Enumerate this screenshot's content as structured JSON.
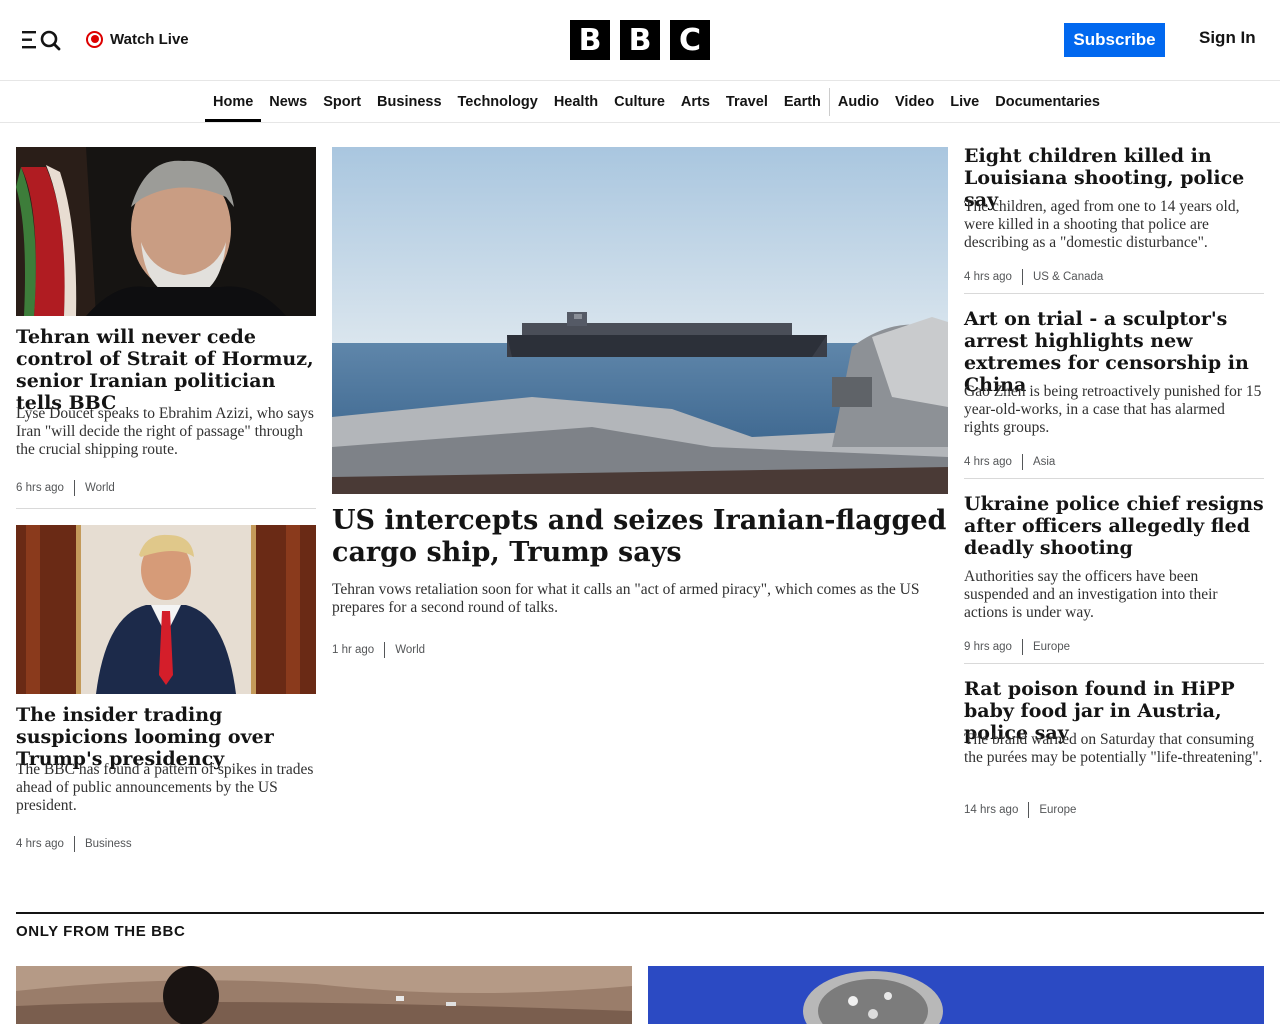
{
  "header": {
    "watch_live": "Watch Live",
    "logo_letters": [
      "B",
      "B",
      "C"
    ],
    "subscribe": "Subscribe",
    "sign_in": "Sign In"
  },
  "nav": [
    "Home",
    "News",
    "Sport",
    "Business",
    "Technology",
    "Health",
    "Culture",
    "Arts",
    "Travel",
    "Earth",
    "Audio",
    "Video",
    "Live",
    "Documentaries"
  ],
  "left_stories": [
    {
      "title": "Tehran will never cede control of Strait of Hormuz, senior Iranian politician tells BBC",
      "summary": "Lyse Doucet speaks to Ebrahim Azizi, who says Iran \"will decide the right of passage\" through the crucial shipping route.",
      "time": "6 hrs ago",
      "category": "World"
    },
    {
      "title": "The insider trading suspicions looming over Trump's presidency",
      "summary": "The BBC has found a pattern of spikes in trades ahead of public announcements by the US president.",
      "time": "4 hrs ago",
      "category": "Business"
    }
  ],
  "lead_story": {
    "title": "US intercepts and seizes Iranian-flagged cargo ship, Trump says",
    "summary": "Tehran vows retaliation soon for what it calls an \"act of armed piracy\", which comes as the US prepares for a second round of talks.",
    "time": "1 hr ago",
    "category": "World"
  },
  "right_stories": [
    {
      "title": "Eight children killed in Louisiana shooting, police say",
      "summary": "The children, aged from one to 14 years old, were killed in a shooting that police are describing as a \"domestic disturbance\".",
      "time": "4 hrs ago",
      "category": "US & Canada"
    },
    {
      "title": "Art on trial - a sculptor's arrest highlights new extremes for censorship in China",
      "summary": "Gao Zhen is being retroactively punished for 15 year-old-works, in a case that has alarmed rights groups.",
      "time": "4 hrs ago",
      "category": "Asia"
    },
    {
      "title": "Ukraine police chief resigns after officers allegedly fled deadly shooting",
      "summary": "Authorities say the officers have been suspended and an investigation into their actions is under way.",
      "time": "9 hrs ago",
      "category": "Europe"
    },
    {
      "title": "Rat poison found in HiPP baby food jar in Austria, police say",
      "summary": "The brand warned on Saturday that consuming the purées may be potentially \"life-threatening\".",
      "time": "14 hrs ago",
      "category": "Europe"
    }
  ],
  "section": {
    "title": "ONLY FROM THE BBC"
  },
  "icons": {
    "menu": "menu-search-icon",
    "live": "live-record-icon"
  },
  "colors": {
    "subscribe": "#0168ef",
    "live": "#dd0000"
  }
}
